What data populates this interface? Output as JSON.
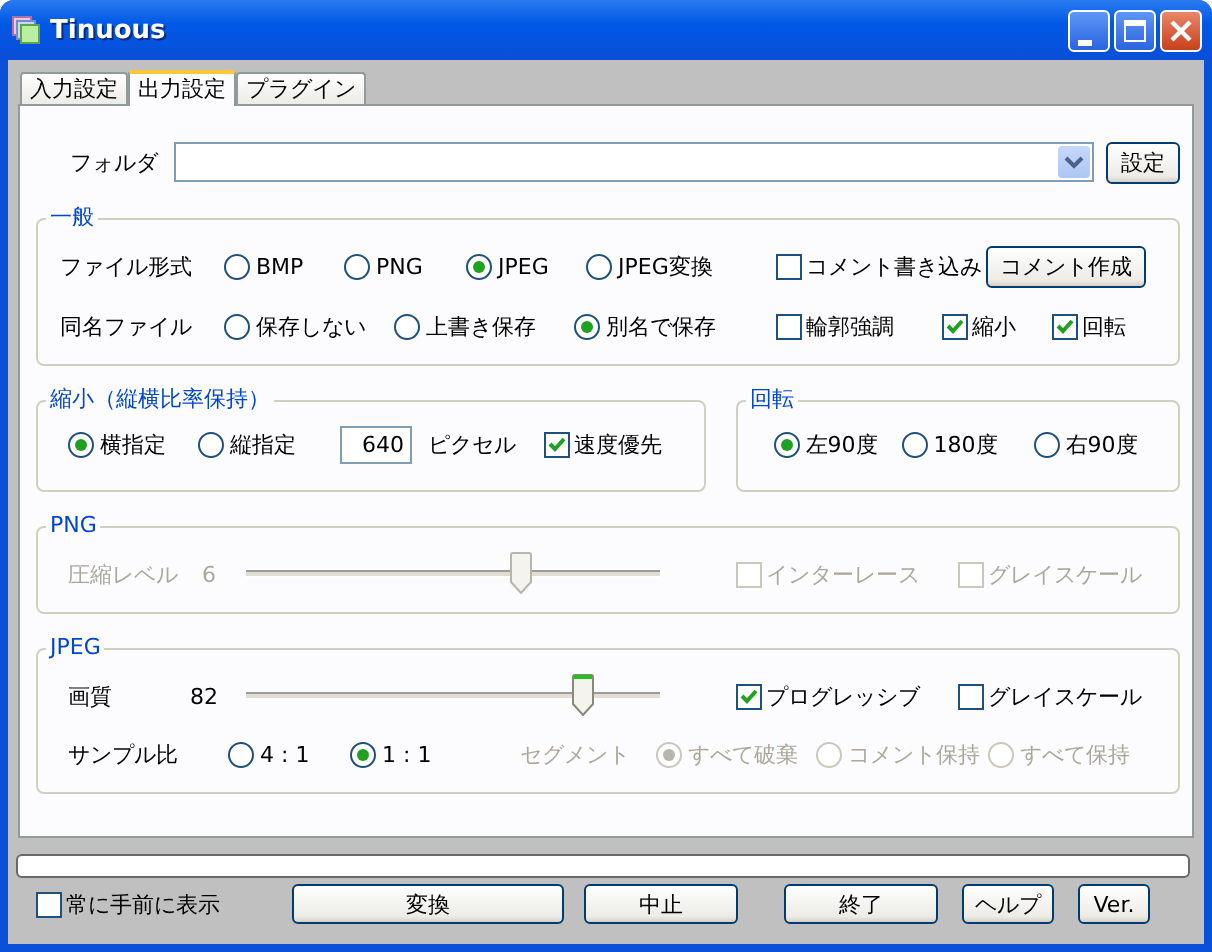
{
  "window": {
    "title": "Tinuous"
  },
  "tabs": [
    {
      "label": "入力設定",
      "selected": false
    },
    {
      "label": "出力設定",
      "selected": true
    },
    {
      "label": "プラグイン",
      "selected": false
    }
  ],
  "folder": {
    "label": "フォルダ",
    "button": "設定"
  },
  "general": {
    "title": "一般",
    "file_format": {
      "label": "ファイル形式",
      "options": [
        {
          "label": "BMP",
          "selected": false
        },
        {
          "label": "PNG",
          "selected": false
        },
        {
          "label": "JPEG",
          "selected": true
        },
        {
          "label": "JPEG変換",
          "selected": false
        }
      ]
    },
    "comment_write": {
      "label": "コメント書き込み",
      "checked": false
    },
    "comment_button": "コメント作成",
    "same_name": {
      "label": "同名ファイル",
      "options": [
        {
          "label": "保存しない",
          "selected": false
        },
        {
          "label": "上書き保存",
          "selected": false
        },
        {
          "label": "別名で保存",
          "selected": true
        }
      ]
    },
    "checkboxes": [
      {
        "label": "輪郭強調",
        "checked": false
      },
      {
        "label": "縮小",
        "checked": true
      },
      {
        "label": "回転",
        "checked": true
      }
    ]
  },
  "resize": {
    "title": "縮小（縦横比率保持）",
    "options": [
      {
        "label": "横指定",
        "selected": true
      },
      {
        "label": "縦指定",
        "selected": false
      }
    ],
    "value": "640",
    "unit": "ピクセル",
    "speed": {
      "label": "速度優先",
      "checked": true
    }
  },
  "rotate": {
    "title": "回転",
    "options": [
      {
        "label": "左90度",
        "selected": true
      },
      {
        "label": "180度",
        "selected": false
      },
      {
        "label": "右90度",
        "selected": false
      }
    ]
  },
  "png": {
    "title": "PNG",
    "disabled": true,
    "compression": {
      "label": "圧縮レベル",
      "value": "6",
      "level": 0.66
    },
    "checkboxes": [
      {
        "label": "インターレース",
        "checked": false
      },
      {
        "label": "グレイスケール",
        "checked": false
      }
    ]
  },
  "jpeg": {
    "title": "JPEG",
    "quality": {
      "label": "画質",
      "value": "82",
      "level": 0.81
    },
    "checkboxes": [
      {
        "label": "プログレッシブ",
        "checked": true
      },
      {
        "label": "グレイスケール",
        "checked": false
      }
    ],
    "sampling": {
      "label": "サンプル比",
      "options": [
        {
          "label": "4 : 1",
          "selected": false
        },
        {
          "label": "1 : 1",
          "selected": true
        }
      ]
    },
    "segment": {
      "label": "セグメント",
      "disabled": true,
      "options": [
        {
          "label": "すべて破棄",
          "selected": true
        },
        {
          "label": "コメント保持",
          "selected": false
        },
        {
          "label": "すべて保持",
          "selected": false
        }
      ]
    }
  },
  "progress": {
    "level": 0
  },
  "always_on_top": {
    "label": "常に手前に表示",
    "checked": false
  },
  "buttons": [
    "変換",
    "中止",
    "終了",
    "ヘルプ",
    "Ver."
  ]
}
